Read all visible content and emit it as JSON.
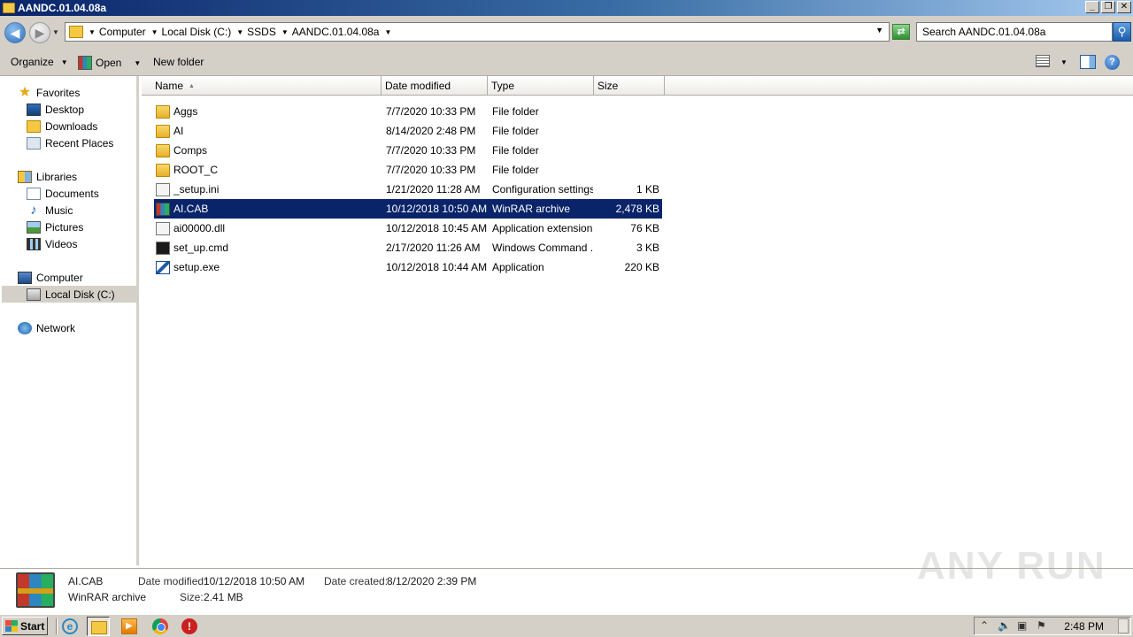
{
  "window": {
    "title": "AANDC.01.04.08a"
  },
  "address": {
    "crumbs": [
      "Computer",
      "Local Disk (C:)",
      "SSDS",
      "AANDC.01.04.08a"
    ],
    "search_placeholder": "Search AANDC.01.04.08a"
  },
  "toolbar": {
    "organize": "Organize",
    "open": "Open",
    "new_folder": "New folder"
  },
  "nav": {
    "favorites": "Favorites",
    "desktop": "Desktop",
    "downloads": "Downloads",
    "recent": "Recent Places",
    "libraries": "Libraries",
    "documents": "Documents",
    "music": "Music",
    "pictures": "Pictures",
    "videos": "Videos",
    "computer": "Computer",
    "local_disk": "Local Disk (C:)",
    "network": "Network"
  },
  "columns": {
    "name": "Name",
    "date": "Date modified",
    "type": "Type",
    "size": "Size"
  },
  "files": [
    {
      "name": "Aggs",
      "date": "7/7/2020 10:33 PM",
      "type": "File folder",
      "size": "",
      "icon": "folder-icon"
    },
    {
      "name": "AI",
      "date": "8/14/2020 2:48 PM",
      "type": "File folder",
      "size": "",
      "icon": "folder-icon"
    },
    {
      "name": "Comps",
      "date": "7/7/2020 10:33 PM",
      "type": "File folder",
      "size": "",
      "icon": "folder-icon"
    },
    {
      "name": "ROOT_C",
      "date": "7/7/2020 10:33 PM",
      "type": "File folder",
      "size": "",
      "icon": "folder-icon"
    },
    {
      "name": "_setup.ini",
      "date": "1/21/2020 11:28 AM",
      "type": "Configuration settings",
      "size": "1 KB",
      "icon": "ini-file-icon"
    },
    {
      "name": "AI.CAB",
      "date": "10/12/2018 10:50 AM",
      "type": "WinRAR archive",
      "size": "2,478 KB",
      "icon": "winrar-archive-icon"
    },
    {
      "name": "ai00000.dll",
      "date": "10/12/2018 10:45 AM",
      "type": "Application extension",
      "size": "76 KB",
      "icon": "dll-file-icon"
    },
    {
      "name": "set_up.cmd",
      "date": "2/17/2020 11:26 AM",
      "type": "Windows Command ...",
      "size": "3 KB",
      "icon": "cmd-file-icon"
    },
    {
      "name": "setup.exe",
      "date": "10/12/2018 10:44 AM",
      "type": "Application",
      "size": "220 KB",
      "icon": "exe-file-icon"
    }
  ],
  "details": {
    "name": "AI.CAB",
    "type": "WinRAR archive",
    "modified_label": "Date modified:",
    "modified_value": "10/12/2018 10:50 AM",
    "created_label": "Date created:",
    "created_value": "8/12/2020 2:39 PM",
    "size_label": "Size:",
    "size_value": "2.41 MB"
  },
  "watermark": "ANY RUN",
  "taskbar": {
    "start": "Start",
    "clock": "2:48 PM"
  }
}
